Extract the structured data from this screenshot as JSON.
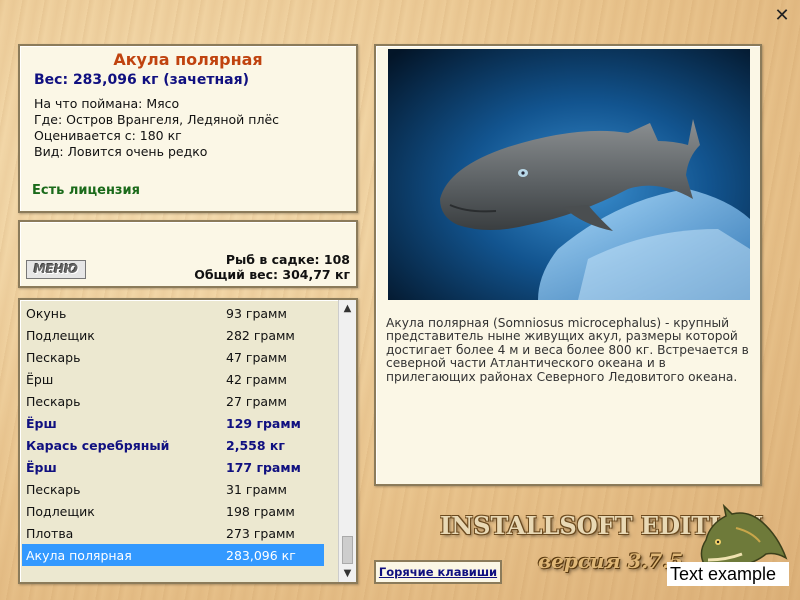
{
  "info": {
    "title": "Акула полярная",
    "weight": "Вес: 283,096 кг (зачетная)",
    "caught_on": "На что поймана: Мясо",
    "location": "Где: Остров Врангеля, Ледяной плёс",
    "valued_from": "Оценивается с: 180 кг",
    "view": "Вид: Ловится очень редко",
    "license": "Есть лицензия"
  },
  "cage": {
    "menu_label": "МЕНЮ",
    "fish_count": "Рыб в садке: 108",
    "total_weight": "Общий вес: 304,77 кг"
  },
  "fish_list": [
    {
      "name": "Окунь",
      "weight": "93 грамм"
    },
    {
      "name": "Подлещик",
      "weight": "282 грамм"
    },
    {
      "name": "Пескарь",
      "weight": "47 грамм"
    },
    {
      "name": "Ёрш",
      "weight": "42 грамм"
    },
    {
      "name": "Пескарь",
      "weight": "27 грамм"
    },
    {
      "name": "Ёрш",
      "weight": "129 грамм"
    },
    {
      "name": "Карась серебряный",
      "weight": "2,558 кг"
    },
    {
      "name": "Ёрш",
      "weight": "177 грамм"
    },
    {
      "name": "Пескарь",
      "weight": "31 грамм"
    },
    {
      "name": "Подлещик",
      "weight": "198 грамм"
    },
    {
      "name": "Плотва",
      "weight": "273 грамм"
    },
    {
      "name": "Акула полярная",
      "weight": "283,096 кг"
    }
  ],
  "description": "Акула полярная (Somniosus microcephalus) - крупный представитель ныне живущих акул, размеры которой достигает более 4 м и веса более 800 кг. Встречается в северной части Атлантического океана и в прилегающих районах Северного Ледовитого океана.",
  "hotkeys_label": "Горячие клавиши",
  "brand": "INSTALLSOFT EDITION",
  "version": "версия 3.7.5",
  "overlay_text": "Text example",
  "colors": {
    "title": "#c0430f",
    "weight": "#101080",
    "license": "#1a6a1a",
    "highlight": "#101080",
    "selection": "#3399ff"
  },
  "icons": {
    "close": "close-icon",
    "scroll_up": "chevron-up-icon",
    "scroll_down": "chevron-down-icon",
    "logo": "pike-fish-icon"
  }
}
